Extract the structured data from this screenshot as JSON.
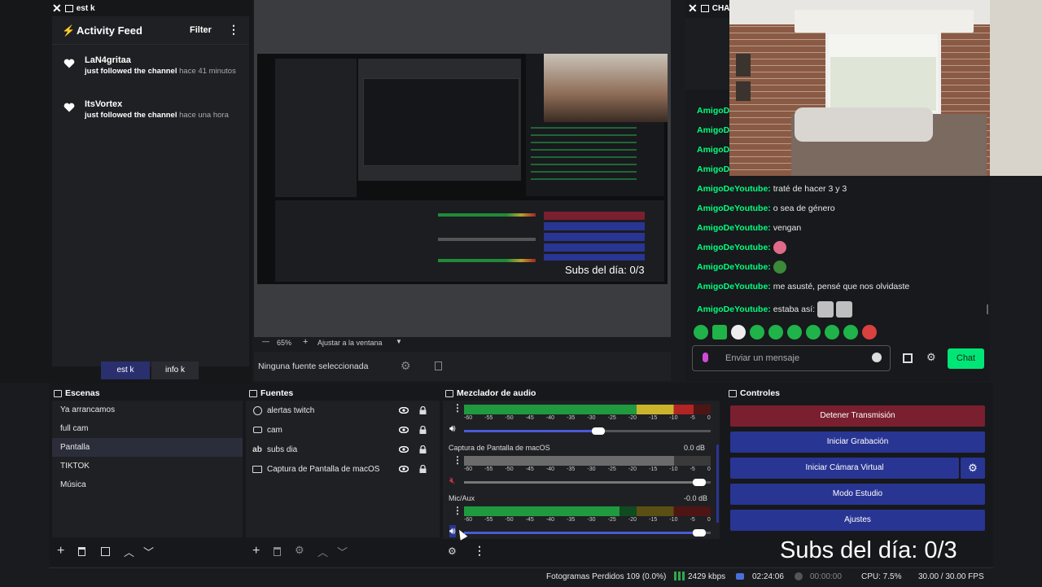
{
  "left_dock": {
    "window_label": "est k",
    "title": "Activity Feed",
    "filter_label": "Filter",
    "follows": [
      {
        "name": "LaN4gritaa",
        "action": "just followed the channel",
        "time": "hace 41 minutos"
      },
      {
        "name": "ItsVortex",
        "action": "just followed the channel",
        "time": "hace una hora"
      }
    ],
    "tabs": [
      "est k",
      "info k"
    ]
  },
  "preview": {
    "zoom": "65%",
    "fit_label": "Ajustar a la ventana",
    "no_source": "Ninguna fuente seleccionada",
    "inner_subs": "Subs del día: 0/3"
  },
  "chat": {
    "window_label": "CHAT",
    "partial_user": "AmigoD",
    "messages": [
      {
        "user": "AmigoDeYoutube:",
        "text": "traté de hacer 3 y 3"
      },
      {
        "user": "AmigoDeYoutube:",
        "text": "o sea de género"
      },
      {
        "user": "AmigoDeYoutube:",
        "text": "vengan"
      },
      {
        "user": "AmigoDeYoutube:",
        "text": ""
      },
      {
        "user": "AmigoDeYoutube:",
        "text": ""
      },
      {
        "user": "AmigoDeYoutube:",
        "text": "me asusté, pensé que nos olvidaste"
      },
      {
        "user": "AmigoDeYoutube:",
        "text": "estaba así:"
      }
    ],
    "input_placeholder": "Enviar un mensaje",
    "send_label": "Chat"
  },
  "scenes": {
    "title": "Escenas",
    "items": [
      "Ya arrancamos",
      "full cam",
      "Pantalla",
      "TIKTOK",
      "Música"
    ],
    "selected": "Pantalla"
  },
  "sources": {
    "title": "Fuentes",
    "items": [
      {
        "label": "alertas twitch",
        "icon": "globe-icon"
      },
      {
        "label": "cam",
        "icon": "camera-icon"
      },
      {
        "label": "subs dia",
        "icon": "text-icon"
      },
      {
        "label": "Captura de Pantalla de macOS",
        "icon": "monitor-icon"
      }
    ]
  },
  "mixer": {
    "title": "Mezclador de audio",
    "tick_labels": [
      "-60",
      "-55",
      "-50",
      "-45",
      "-40",
      "-35",
      "-30",
      "-25",
      "-20",
      "-15",
      "-10",
      "-5",
      "0"
    ],
    "channels": [
      {
        "name": "",
        "db": "",
        "level": 0.93,
        "volume": 0.57,
        "muted": false
      },
      {
        "name": "Captura de Pantalla de macOS",
        "db": "0.0 dB",
        "level": 0.85,
        "volume": 0.98,
        "muted": true
      },
      {
        "name": "Mic/Aux",
        "db": "-0.0 dB",
        "level": 0.63,
        "volume": 0.98,
        "muted": false
      }
    ]
  },
  "controls": {
    "title": "Controles",
    "stop_stream": "Detener Transmisión",
    "start_recording": "Iniciar Grabación",
    "start_virtual_cam": "Iniciar Cámara Virtual",
    "studio_mode": "Modo Estudio",
    "settings": "Ajustes"
  },
  "overlay": {
    "subs_text": "Subs del día: 0/3"
  },
  "status_bar": {
    "dropped_frames": "Fotogramas Perdidos 109 (0.0%)",
    "bitrate": "2429 kbps",
    "stream_time": "02:24:06",
    "rec_time": "00:00:00",
    "cpu": "CPU: 7.5%",
    "fps": "30.00 / 30.00 FPS"
  },
  "colors": {
    "accent_green": "#00e676",
    "stop_red": "#7a1f2f",
    "button_blue": "#283593",
    "chat_user": "#00ff7f",
    "selection": "#2b2e3a"
  }
}
